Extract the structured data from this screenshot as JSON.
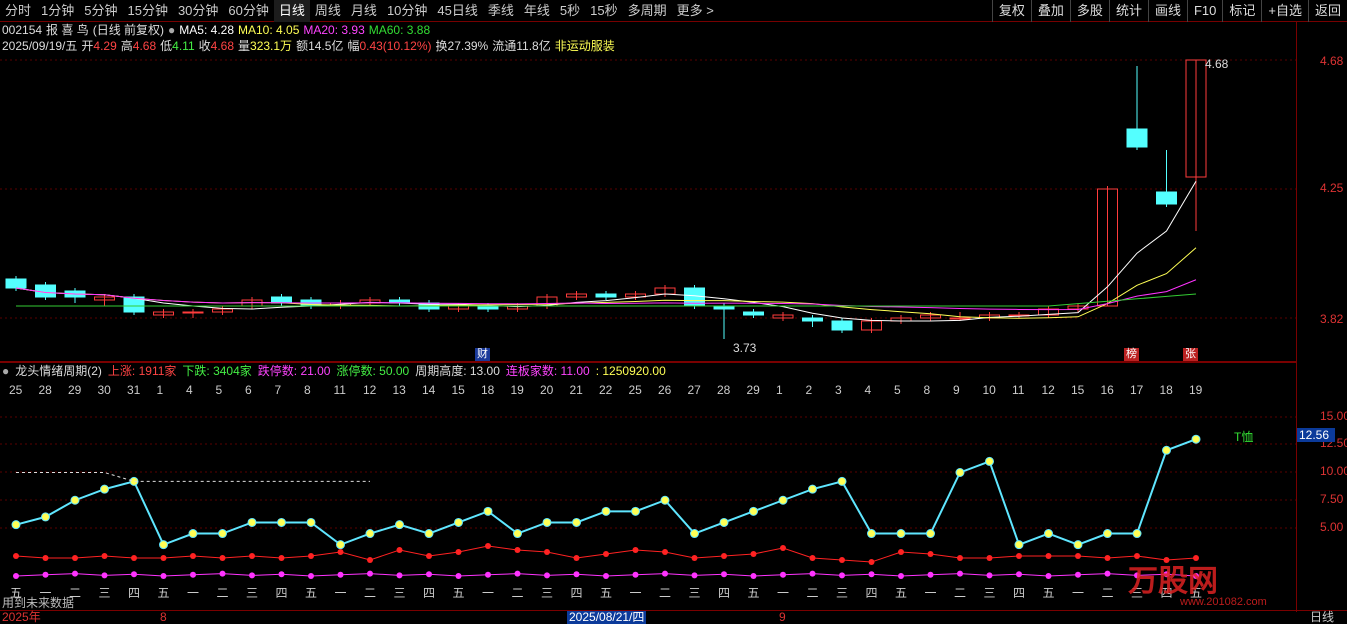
{
  "toolbar": {
    "periods": [
      "分时",
      "1分钟",
      "5分钟",
      "15分钟",
      "30分钟",
      "60分钟",
      "日线",
      "周线",
      "月线",
      "10分钟",
      "45日线",
      "季线",
      "年线",
      "5秒",
      "15秒",
      "多周期",
      "更多 >"
    ],
    "active_period": "日线",
    "tools": [
      "复权",
      "叠加",
      "多股",
      "统计",
      "画线",
      "F10",
      "标记",
      "+自选",
      "返回"
    ]
  },
  "stock": {
    "code": "002154",
    "name": "报 喜 鸟",
    "mode": "(日线 前复权)",
    "ma5": "MA5: 4.28",
    "ma10": "MA10: 4.05",
    "ma20": "MA20: 3.93",
    "ma60": "MA60: 3.88",
    "date": "2025/09/19/五",
    "open_label": "开",
    "open": "4.29",
    "high_label": "高",
    "high": "4.68",
    "low_label": "低",
    "low": "4.11",
    "close_label": "收",
    "close": "4.68",
    "vol_label": "量",
    "vol": "323.1万",
    "amt_label": "额",
    "amt": "14.5亿",
    "chg_label": "幅",
    "chg": "0.43(10.12%)",
    "turn_label": "换",
    "turn": "27.39%",
    "float_label": "流通",
    "float": "11.8亿",
    "sector": "非运动服装"
  },
  "price_axis": {
    "labels": [
      "4.68",
      "4.25",
      "3.82"
    ],
    "high_mark": "4.68",
    "low_mark": "3.73"
  },
  "tags": {
    "cai": "财",
    "bang": "榜",
    "zhang": "张"
  },
  "indicator": {
    "name": "龙头情绪周期(2)",
    "up": "上涨: 1911家",
    "down": "下跌: 3404家",
    "limit_down": "跌停数: 21.00",
    "limit_up": "涨停数: 50.00",
    "cycle_height": "周期高度: 13.00",
    "consec": "连板家数: 11.00",
    "misc": ": 1250920.00",
    "axis": [
      "15.00",
      "12.50",
      "10.00",
      "7.50",
      "5.00"
    ],
    "current": "12.56",
    "signal": "T恤"
  },
  "dates": [
    "25",
    "28",
    "29",
    "30",
    "31",
    "1",
    "4",
    "5",
    "6",
    "7",
    "8",
    "11",
    "12",
    "13",
    "14",
    "15",
    "18",
    "19",
    "20",
    "21",
    "22",
    "25",
    "26",
    "27",
    "28",
    "29",
    "1",
    "2",
    "3",
    "4",
    "5",
    "8",
    "9",
    "10",
    "11",
    "12",
    "15",
    "16",
    "17",
    "18",
    "19"
  ],
  "weekdays": [
    "五",
    "一",
    "二",
    "三",
    "四",
    "五",
    "一",
    "二",
    "三",
    "四",
    "五",
    "一",
    "二",
    "三",
    "四",
    "五",
    "一",
    "二",
    "三",
    "四",
    "五",
    "一",
    "二",
    "三",
    "四",
    "五",
    "一",
    "二",
    "三",
    "四",
    "五",
    "一",
    "二",
    "三",
    "四",
    "五",
    "一",
    "二",
    "三",
    "四",
    "五"
  ],
  "bottom": {
    "year": "2025年",
    "m8": "8",
    "cursor_date": "2025/08/21/四",
    "m9": "9",
    "period": "日线",
    "note": "用到未来数据"
  },
  "watermark": {
    "brand": "万股网",
    "url": "www.201082.com"
  },
  "colors": {
    "up": "#ff3c3c",
    "down": "#54ffff",
    "ma5": "#ffffff",
    "ma10": "#ffff55",
    "ma20": "#ff33ff",
    "ma60": "#33cc33",
    "bg": "#000000",
    "grid": "#7a0000"
  }
}
